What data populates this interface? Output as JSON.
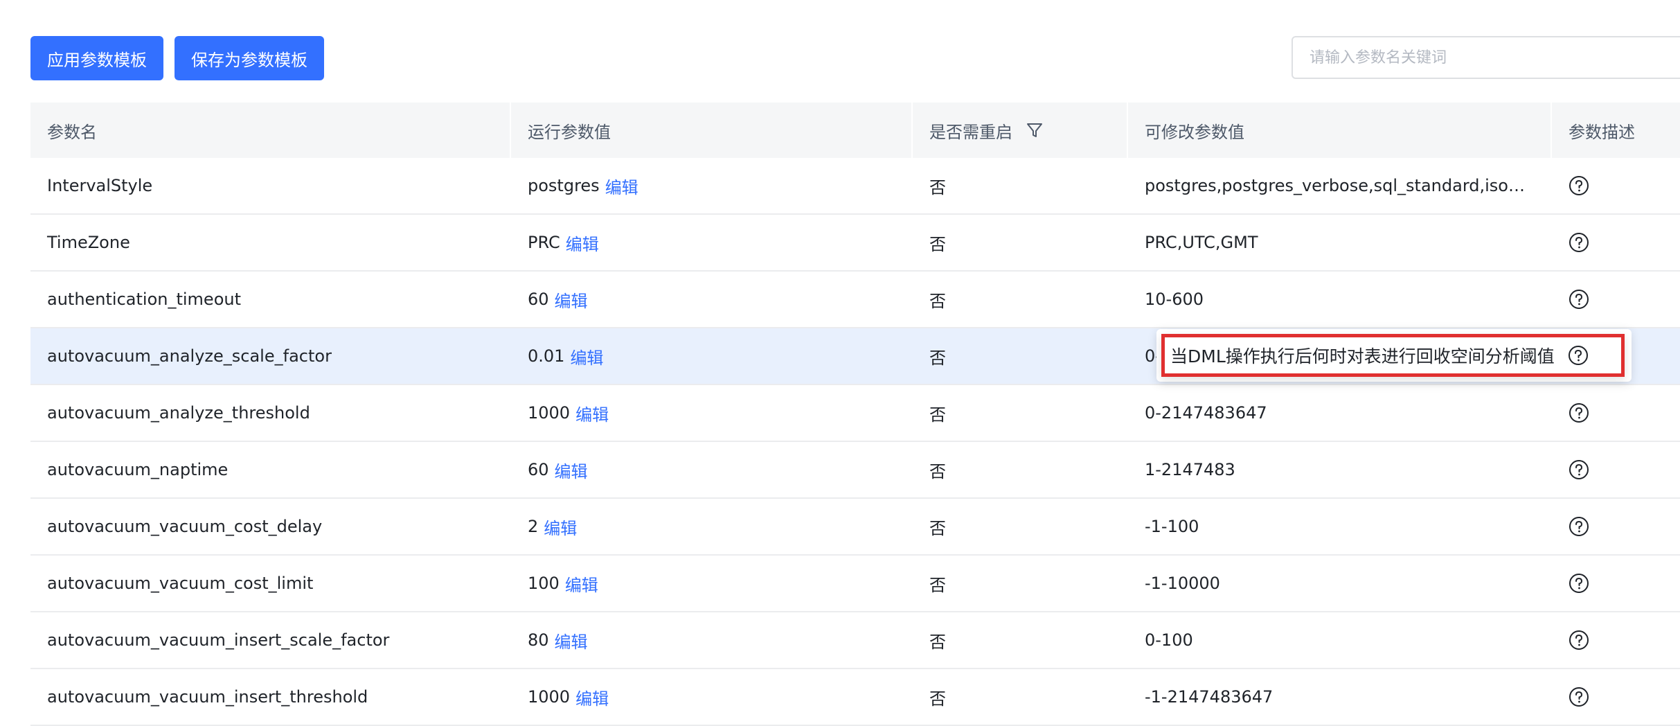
{
  "toolbar": {
    "apply_label": "应用参数模板",
    "save_label": "保存为参数模板"
  },
  "search": {
    "placeholder": "请输入参数名关键词"
  },
  "table": {
    "columns": [
      "参数名",
      "运行参数值",
      "是否需重启",
      "可修改参数值",
      "参数描述"
    ],
    "edit_label": "编辑",
    "rows": [
      {
        "name": "IntervalStyle",
        "value": "postgres",
        "restart": "否",
        "allowed": "postgres,postgres_verbose,sql_standard,iso_8..."
      },
      {
        "name": "TimeZone",
        "value": "PRC",
        "restart": "否",
        "allowed": "PRC,UTC,GMT"
      },
      {
        "name": "authentication_timeout",
        "value": "60",
        "restart": "否",
        "allowed": "10-600"
      },
      {
        "name": "autovacuum_analyze_scale_factor",
        "value": "0.01",
        "restart": "否",
        "allowed": "0-"
      },
      {
        "name": "autovacuum_analyze_threshold",
        "value": "1000",
        "restart": "否",
        "allowed": "0-2147483647"
      },
      {
        "name": "autovacuum_naptime",
        "value": "60",
        "restart": "否",
        "allowed": "1-2147483"
      },
      {
        "name": "autovacuum_vacuum_cost_delay",
        "value": "2",
        "restart": "否",
        "allowed": "-1-100"
      },
      {
        "name": "autovacuum_vacuum_cost_limit",
        "value": "100",
        "restart": "否",
        "allowed": "-1-10000"
      },
      {
        "name": "autovacuum_vacuum_insert_scale_factor",
        "value": "80",
        "restart": "否",
        "allowed": "0-100"
      },
      {
        "name": "autovacuum_vacuum_insert_threshold",
        "value": "1000",
        "restart": "否",
        "allowed": "-1-2147483647"
      }
    ]
  },
  "tooltip": {
    "text": "当DML操作执行后何时对表进行回收空间分析阈值"
  },
  "colors": {
    "primary": "#3370ff",
    "highlight_row": "#e8f0fd",
    "annotation_red": "#e02f2f"
  }
}
